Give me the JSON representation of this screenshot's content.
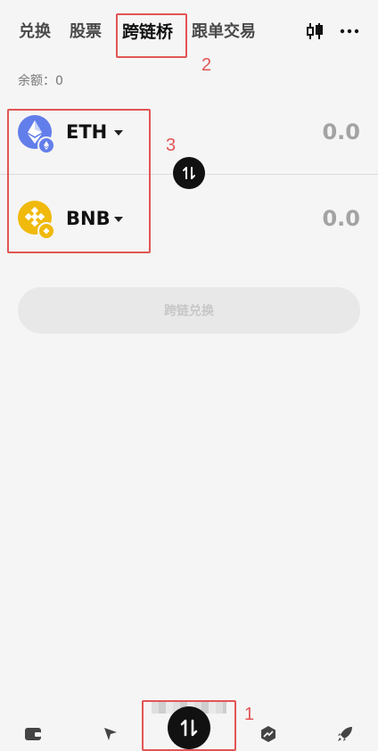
{
  "tabs": [
    {
      "label": "兑换"
    },
    {
      "label": "股票"
    },
    {
      "label": "跨链桥"
    },
    {
      "label": "跟单交易"
    }
  ],
  "balance_label": "余额：0",
  "from_token": {
    "symbol": "ETH",
    "amount": "0.0"
  },
  "to_token": {
    "symbol": "BNB",
    "amount": "0.0"
  },
  "action_button": "跨链兑换",
  "annotations": {
    "one": "1",
    "two": "2",
    "three": "3"
  },
  "colors": {
    "eth": "#627eea",
    "bnb": "#f0b90b",
    "highlight": "#e25555"
  },
  "icons": {
    "top": [
      "candlestick-chart-icon",
      "more-icon"
    ],
    "bottom_nav": [
      "wallet-icon",
      "explore-icon",
      "swap-icon",
      "trend-icon",
      "rocket-icon"
    ]
  }
}
